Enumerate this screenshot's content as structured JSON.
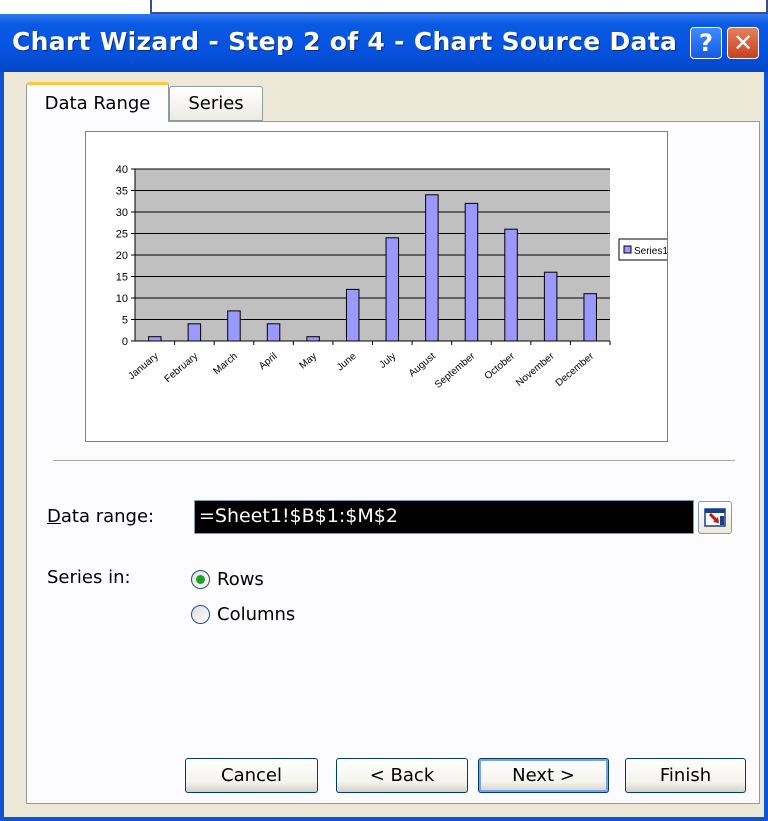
{
  "window": {
    "title": "Chart Wizard - Step 2 of 4 - Chart Source Data",
    "help_glyph": "?",
    "close_glyph": "✕"
  },
  "tabs": [
    {
      "label": "Data Range",
      "active": true
    },
    {
      "label": "Series",
      "active": false
    }
  ],
  "form": {
    "data_range_label": "Data range:",
    "data_range_value": "=Sheet1!$B$1:$M$2",
    "series_in_label": "Series in:",
    "options": [
      {
        "label": "Rows",
        "selected": true
      },
      {
        "label": "Columns",
        "selected": false
      }
    ]
  },
  "buttons": {
    "cancel": "Cancel",
    "back": "< Back",
    "next": "Next >",
    "finish": "Finish"
  },
  "chart_data": {
    "type": "bar",
    "categories": [
      "January",
      "February",
      "March",
      "April",
      "May",
      "June",
      "July",
      "August",
      "September",
      "October",
      "November",
      "December"
    ],
    "series": [
      {
        "name": "Series1",
        "values": [
          1,
          4,
          7,
          4,
          1,
          12,
          24,
          34,
          32,
          26,
          16,
          11
        ]
      }
    ],
    "ylim": [
      0,
      40
    ],
    "yticks": [
      0,
      5,
      10,
      15,
      20,
      25,
      30,
      35,
      40
    ],
    "grid": true,
    "legend": "right",
    "colors": {
      "bar": "#9999ff",
      "plot_bg": "#c0c0c0"
    }
  }
}
